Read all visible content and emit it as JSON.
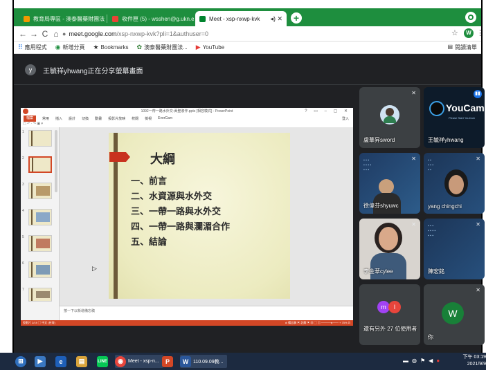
{
  "browser": {
    "tabs": [
      {
        "title": "教育局專區 - 澳泰醫藥財團法人..."
      },
      {
        "title": "收件匣 (5) - wsshen@g.ukn.edu..."
      },
      {
        "title": "Meet - xsp-nxwp-kvk",
        "active": true
      }
    ],
    "new_tab": "+",
    "url_host": "meet.google.com",
    "url_path": "/xsp-nxwp-kvk?pli=1&authuser=0",
    "account_initial": "W",
    "bookmarks": [
      {
        "label": "應用程式",
        "icon": "apps-grid-icon"
      },
      {
        "label": "新增分頁",
        "icon": "chrome-icon"
      },
      {
        "label": "Bookmarks",
        "icon": "star-icon"
      },
      {
        "label": "澳泰醫藥財團法...",
        "icon": "site-icon"
      },
      {
        "label": "YouTube",
        "icon": "youtube-icon"
      }
    ],
    "reading_list": "閱讀清單"
  },
  "meet": {
    "presenter_initial": "y",
    "presenting_banner": "王毓祥yhwang正在分享螢幕畫面",
    "cursor": "▷"
  },
  "powerpoint": {
    "window_title": "1092一帶一路水外交-黃聖淑作.pptx [相容模式] - PowerPoint",
    "window_controls": "? ▭ – ▢ ✕",
    "ribbon_tabs": [
      "檔案",
      "常用",
      "插入",
      "設計",
      "切換",
      "動畫",
      "投影片放映",
      "校閱",
      "檢視",
      "EverCam"
    ],
    "sign_in": "登入",
    "quick_access": "▢ ↶ · ↷ ▣ ▾",
    "thumb_numbers": [
      "1",
      "2",
      "3",
      "4",
      "5",
      "6",
      "7"
    ],
    "notes_placeholder": "按一下以新增備忘稿",
    "status_left": "投影片 2/19   ▢   中文 (台灣)",
    "status_right": "≐ 備忘稿   ▣ 註解   ▣ ▦ ▢ ▤   ─────●─── + 75%  ⊡",
    "slide": {
      "title": "大綱",
      "items": [
        "一、前言",
        "二、水資源與水外交",
        "三、一帶一路與水外交",
        "四、一帶一路與瀾湄合作",
        "五、結論"
      ]
    }
  },
  "participants": [
    {
      "name": "盧華昇sword",
      "kind": "avatar-photo",
      "muted": true
    },
    {
      "name": "王毓祥yhwang",
      "kind": "youcam",
      "youcam_brand": "YouCam",
      "youcam_sub": "Please Start YouCam",
      "speaking": true
    },
    {
      "name": "徐偉芬shyuwc",
      "kind": "camera",
      "muted": true
    },
    {
      "name": "yang chingchi",
      "kind": "camera",
      "muted": true
    },
    {
      "name": "李金華cylee",
      "kind": "camera",
      "muted": true
    },
    {
      "name": "陳宏銘",
      "kind": "screen",
      "muted": true
    },
    {
      "name": "還有另外 27 位使用者",
      "kind": "others",
      "initials": [
        "m",
        "l"
      ]
    },
    {
      "name": "你",
      "kind": "self",
      "initial": "W",
      "muted": true
    }
  ],
  "taskbar": {
    "start": "⊞",
    "items": [
      {
        "label": "",
        "icon": "media-player-icon"
      },
      {
        "label": "",
        "icon": "ie-icon"
      },
      {
        "label": "",
        "icon": "explorer-icon"
      },
      {
        "label": "",
        "icon": "line-icon"
      },
      {
        "label": "Meet - xsp-n...",
        "icon": "chrome-icon"
      },
      {
        "label": "",
        "icon": "powerpoint-icon"
      },
      {
        "label": "110.09.09教...",
        "icon": "word-icon"
      }
    ],
    "time": "下午 03:19",
    "date": "2021/9/9"
  },
  "colors": {
    "chrome_green": "#1e8e3e",
    "meet_bg": "#202124",
    "ppt_orange": "#d24726",
    "slide_accent": "#c8321e",
    "speaking_blue": "#1a73e8"
  }
}
